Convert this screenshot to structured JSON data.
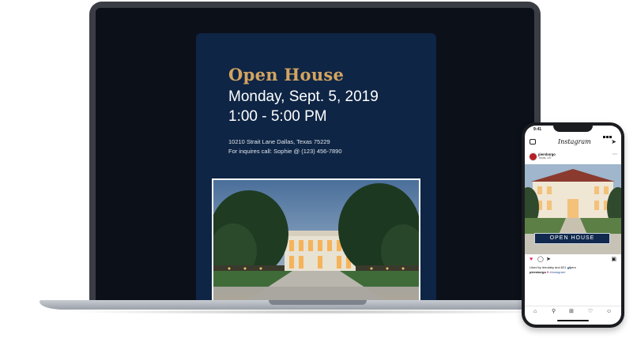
{
  "flyer": {
    "title": "Open House",
    "date": "Monday, Sept. 5, 2019",
    "time": "1:00 - 5:00 PM",
    "address": "10210 Strait Lane Dallas, Texas 75229",
    "contact": "For inquires call: Sophie @ (123) 456-7890"
  },
  "phone": {
    "status_time": "9:41",
    "app_title": "Instagram",
    "post": {
      "username": "piersborgo",
      "location": "Texas, US",
      "banner": "OPEN HOUSE",
      "liked_by": "Liked by leeolaby and 621 others",
      "caption_user": "piersborgo",
      "caption_tag": "#instagram"
    },
    "icons": {
      "camera": "camera-icon",
      "send": "direct-message-icon",
      "more": "more-icon",
      "like": "heart-icon",
      "comment": "comment-icon",
      "share": "share-icon",
      "save": "bookmark-icon",
      "home": "home-icon",
      "search": "search-icon",
      "add": "add-post-icon",
      "activity": "activity-icon",
      "profile": "profile-icon"
    },
    "colors": {
      "heart": "#e0245e",
      "banner_bg": "#10294d"
    }
  },
  "colors": {
    "flyer_bg": "#0e2545",
    "title_gold": "#d3a461",
    "screen_bg": "#0b1019"
  }
}
